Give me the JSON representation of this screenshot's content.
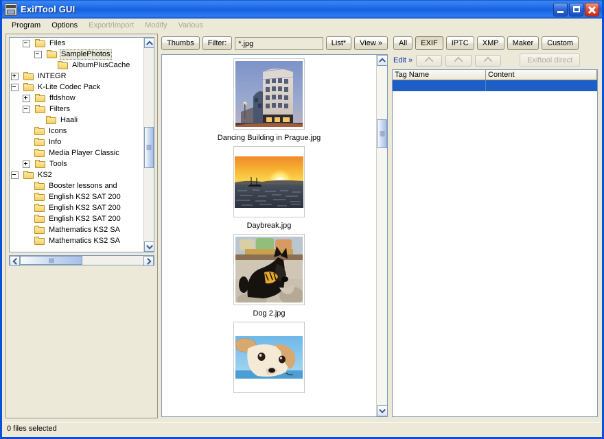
{
  "window": {
    "title": "ExifTool GUI",
    "icon": "app-icon",
    "buttons": {
      "minimize": "minimize-button",
      "maximize": "maximize-button",
      "close": "close-button"
    }
  },
  "menubar": {
    "items": [
      {
        "label": "Program",
        "enabled": true
      },
      {
        "label": "Options",
        "enabled": true
      },
      {
        "label": "Export/Import",
        "enabled": false
      },
      {
        "label": "Modify",
        "enabled": false
      },
      {
        "label": "Various",
        "enabled": false
      }
    ]
  },
  "tree": {
    "nodes": [
      {
        "label": "Files",
        "indent": 2,
        "toggle": "minus",
        "selected": false
      },
      {
        "label": "SamplePhotos",
        "indent": 3,
        "toggle": "minus",
        "selected": true
      },
      {
        "label": "AlbumPlusCache",
        "indent": 4,
        "toggle": "none",
        "selected": false
      },
      {
        "label": "INTEGR",
        "indent": 1,
        "toggle": "plus",
        "selected": false
      },
      {
        "label": "K-Lite Codec Pack",
        "indent": 1,
        "toggle": "minus",
        "selected": false
      },
      {
        "label": "ffdshow",
        "indent": 2,
        "toggle": "plus",
        "selected": false
      },
      {
        "label": "Filters",
        "indent": 2,
        "toggle": "minus",
        "selected": false
      },
      {
        "label": "Haali",
        "indent": 3,
        "toggle": "none",
        "selected": false
      },
      {
        "label": "Icons",
        "indent": 2,
        "toggle": "none",
        "selected": false
      },
      {
        "label": "Info",
        "indent": 2,
        "toggle": "none",
        "selected": false
      },
      {
        "label": "Media Player Classic",
        "indent": 2,
        "toggle": "none",
        "selected": false
      },
      {
        "label": "Tools",
        "indent": 2,
        "toggle": "plus",
        "selected": false
      },
      {
        "label": "KS2",
        "indent": 1,
        "toggle": "minus",
        "selected": false
      },
      {
        "label": "Booster lessons and",
        "indent": 2,
        "toggle": "none",
        "selected": false
      },
      {
        "label": "English KS2 SAT 200",
        "indent": 2,
        "toggle": "none",
        "selected": false
      },
      {
        "label": "English KS2 SAT 200",
        "indent": 2,
        "toggle": "none",
        "selected": false
      },
      {
        "label": "English KS2 SAT 200",
        "indent": 2,
        "toggle": "none",
        "selected": false
      },
      {
        "label": "Mathematics KS2 SA",
        "indent": 2,
        "toggle": "none",
        "selected": false
      },
      {
        "label": "Mathematics KS2 SA",
        "indent": 2,
        "toggle": "none",
        "selected": false
      }
    ]
  },
  "center_toolbar": {
    "thumbs_label": "Thumbs",
    "filter_label": "Filter:",
    "filter_value": "*.jpg",
    "list_label": "List*",
    "view_label": "View »"
  },
  "thumbnails": [
    {
      "caption": "Dancing Building in Prague.jpg",
      "image": "dancing-house-thumbnail"
    },
    {
      "caption": "Daybreak.jpg",
      "image": "sunset-sea-thumbnail"
    },
    {
      "caption": "Dog 2.jpg",
      "image": "black-terrier-thumbnail"
    },
    {
      "caption": "",
      "image": "dog-face-thumbnail"
    }
  ],
  "right_toolbar": {
    "tabs": [
      {
        "label": "All",
        "pressed": false
      },
      {
        "label": "EXIF",
        "pressed": true
      },
      {
        "label": "IPTC",
        "pressed": false
      },
      {
        "label": "XMP",
        "pressed": false
      },
      {
        "label": "Maker",
        "pressed": false
      },
      {
        "label": "Custom",
        "pressed": false
      }
    ],
    "edit_label": "Edit »",
    "exiftool_direct_label": "Exiftool direct"
  },
  "tag_table": {
    "columns": [
      "Tag Name",
      "Content"
    ],
    "rows": [
      {
        "tag": "",
        "content": ""
      }
    ]
  },
  "statusbar": {
    "text": "0 files selected"
  },
  "colors": {
    "titlebar_blue": "#1560e0",
    "window_border": "#0a50d8",
    "face": "#ece9d8",
    "selection_blue": "#1d5fc4",
    "link_blue": "#0a3ab4",
    "disabled_text": "#aca899"
  }
}
